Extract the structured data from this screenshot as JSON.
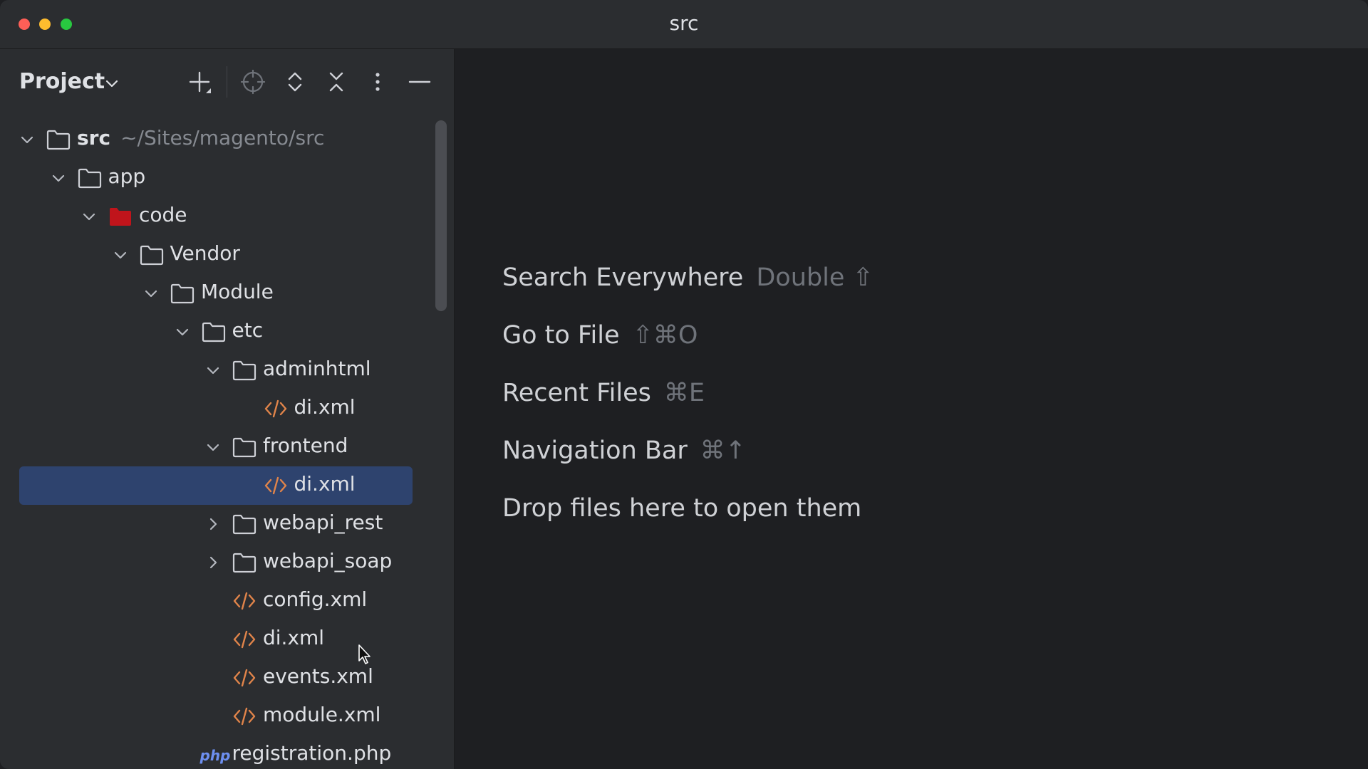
{
  "window": {
    "title": "src"
  },
  "project_panel": {
    "title": "Project",
    "toolbar": [
      "add-icon",
      "locate-icon",
      "expand-all-icon",
      "collapse-all-icon",
      "more-options-icon",
      "hide-panel-icon"
    ]
  },
  "tree": [
    {
      "label": "src",
      "hint": "~/Sites/magento/src",
      "type": "folder",
      "depth": 0,
      "expanded": true,
      "bold": true
    },
    {
      "label": "app",
      "type": "folder",
      "depth": 1,
      "expanded": true
    },
    {
      "label": "code",
      "type": "folder-red",
      "depth": 2,
      "expanded": true
    },
    {
      "label": "Vendor",
      "type": "folder",
      "depth": 3,
      "expanded": true
    },
    {
      "label": "Module",
      "type": "folder",
      "depth": 4,
      "expanded": true
    },
    {
      "label": "etc",
      "type": "folder",
      "depth": 5,
      "expanded": true
    },
    {
      "label": "adminhtml",
      "type": "folder",
      "depth": 6,
      "expanded": true
    },
    {
      "label": "di.xml",
      "type": "xml",
      "depth": 7
    },
    {
      "label": "frontend",
      "type": "folder",
      "depth": 6,
      "expanded": true
    },
    {
      "label": "di.xml",
      "type": "xml",
      "depth": 7,
      "selected": true
    },
    {
      "label": "webapi_rest",
      "type": "folder",
      "depth": 6,
      "expanded": false
    },
    {
      "label": "webapi_soap",
      "type": "folder",
      "depth": 6,
      "expanded": false
    },
    {
      "label": "config.xml",
      "type": "xml",
      "depth": 6
    },
    {
      "label": "di.xml",
      "type": "xml",
      "depth": 6
    },
    {
      "label": "events.xml",
      "type": "xml",
      "depth": 6
    },
    {
      "label": "module.xml",
      "type": "xml",
      "depth": 6
    },
    {
      "label": "registration.php",
      "type": "php",
      "depth": 5
    }
  ],
  "php_badge": "php",
  "empty_state": {
    "hints": [
      {
        "label": "Search Everywhere",
        "shortcut": "Double ⇧"
      },
      {
        "label": "Go to File",
        "shortcut": "⇧⌘O"
      },
      {
        "label": "Recent Files",
        "shortcut": "⌘E"
      },
      {
        "label": "Navigation Bar",
        "shortcut": "⌘↑"
      },
      {
        "label": "Drop files here to open them",
        "shortcut": ""
      }
    ]
  },
  "colors": {
    "selection": "#2e436e",
    "xml_icon": "#e0844a",
    "php_icon": "#6d8ff0",
    "special_folder": "#c0141b"
  }
}
